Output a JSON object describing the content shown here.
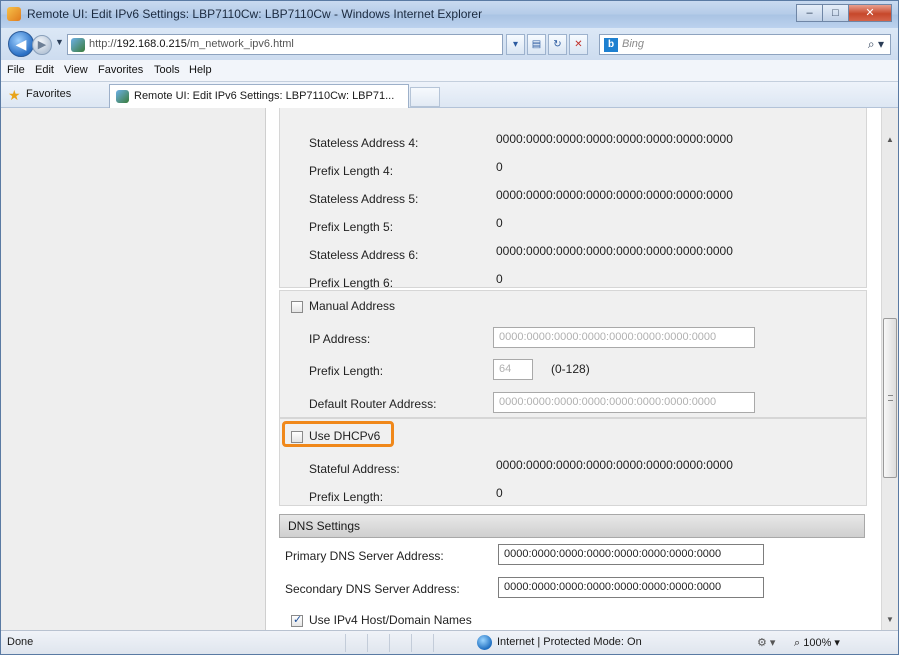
{
  "window": {
    "title": "Remote UI: Edit IPv6 Settings: LBP7110Cw: LBP7110Cw - Windows Internet Explorer",
    "minimize": "–",
    "maximize": "□",
    "close": "✕"
  },
  "addressbar": {
    "url_prefix": "http://",
    "url_host": "192.168.0.215",
    "url_path": "/m_network_ipv6.html",
    "search_placeholder": "Bing",
    "back_glyph": "◀",
    "forward_glyph": "▶",
    "search_go_glyph": "⌕ ▾"
  },
  "menubar": {
    "items": [
      "File",
      "Edit",
      "View",
      "Favorites",
      "Tools",
      "Help"
    ]
  },
  "favbar": {
    "favorites_label": "Favorites",
    "tab_title": "Remote UI: Edit IPv6 Settings: LBP7110Cw: LBP71..."
  },
  "stateless": [
    {
      "label": "Stateless Address 4:",
      "value": "0000:0000:0000:0000:0000:0000:0000:0000"
    },
    {
      "label": "Prefix Length 4:",
      "value": "0"
    },
    {
      "label": "Stateless Address 5:",
      "value": "0000:0000:0000:0000:0000:0000:0000:0000"
    },
    {
      "label": "Prefix Length 5:",
      "value": "0"
    },
    {
      "label": "Stateless Address 6:",
      "value": "0000:0000:0000:0000:0000:0000:0000:0000"
    },
    {
      "label": "Prefix Length 6:",
      "value": "0"
    }
  ],
  "manual": {
    "checkbox_label": "Manual Address",
    "checked": false,
    "ip_label": "IP Address:",
    "ip_value": "0000:0000:0000:0000:0000:0000:0000:0000",
    "prefix_label": "Prefix Length:",
    "prefix_value": "64",
    "prefix_range": "(0-128)",
    "router_label": "Default Router Address:",
    "router_value": "0000:0000:0000:0000:0000:0000:0000:0000"
  },
  "dhcpv6": {
    "checkbox_label": "Use DHCPv6",
    "checked": false,
    "stateful_label": "Stateful Address:",
    "stateful_value": "0000:0000:0000:0000:0000:0000:0000:0000",
    "prefix_label": "Prefix Length:",
    "prefix_value": "0"
  },
  "dns": {
    "section_title": "DNS Settings",
    "primary_label": "Primary DNS Server Address:",
    "primary_value": "0000:0000:0000:0000:0000:0000:0000:0000",
    "secondary_label": "Secondary DNS Server Address:",
    "secondary_value": "0000:0000:0000:0000:0000:0000:0000:0000",
    "use_ipv4_label": "Use IPv4 Host/Domain Names",
    "use_ipv4_checked": true
  },
  "statusbar": {
    "status": "Done",
    "zone": "Internet | Protected Mode: On",
    "protect_glyph": "⚙ ▾",
    "zoom": "⌕ 100%  ▾"
  },
  "colors": {
    "highlight": "#f0881a",
    "chrome": "#dfe9f5"
  }
}
